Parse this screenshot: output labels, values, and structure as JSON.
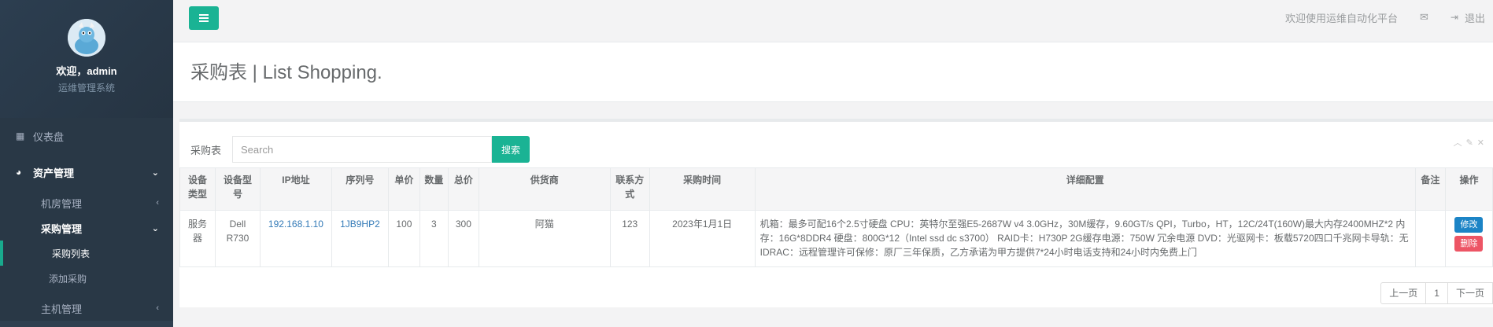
{
  "sidebar": {
    "welcome": "欢迎，admin",
    "role": "运维管理系统",
    "dashboard": "仪表盘",
    "asset_group": "资产管理",
    "sub_room": "机房管理",
    "sub_purchase": "采购管理",
    "purchase_list": "采购列表",
    "purchase_add": "添加采购",
    "sub_host": "主机管理"
  },
  "topbar": {
    "welcome_msg": "欢迎使用运维自动化平台",
    "logout": "退出"
  },
  "page": {
    "title": "采购表 | List Shopping."
  },
  "panel": {
    "search_label": "采购表",
    "search_placeholder": "Search",
    "search_button": "搜索"
  },
  "table": {
    "headers": [
      "设备类型",
      "设备型号",
      "IP地址",
      "序列号",
      "单价",
      "数量",
      "总价",
      "供货商",
      "联系方式",
      "采购时间",
      "详细配置",
      "备注",
      "操作"
    ],
    "rows": [
      {
        "type": "服务器",
        "model": "Dell R730",
        "ip": "192.168.1.10",
        "serial": "1JB9HP2",
        "unit_price": "100",
        "quantity": "3",
        "total": "300",
        "supplier": "阿猫",
        "contact": "123",
        "date": "2023年1月1日",
        "detail": "机箱：最多可配16个2.5寸硬盘 CPU：英特尔至强E5-2687W v4 3.0GHz，30M缓存，9.60GT/s QPI，Turbo，HT，12C/24T(160W)最大内存2400MHZ*2 内存：16G*8DDR4 硬盘：800G*12（Intel ssd dc s3700） RAID卡：H730P 2G缓存电源：750W 冗余电源 DVD：光驱网卡：板载5720四口千兆网卡导轨：无 IDRAC：远程管理许可保修：原厂三年保质，乙方承诺为甲方提供7*24小时电话支持和24小时内免费上门",
        "remark": "",
        "edit": "修改",
        "delete": "删除"
      }
    ]
  },
  "pager": {
    "prev": "上一页",
    "current": "1",
    "next": "下一页"
  },
  "colors": {
    "accent": "#1ab394",
    "sidebar_bg": "#2f4050",
    "link": "#337ab7",
    "danger": "#ed5565",
    "primary": "#1c84c6"
  },
  "icons": [
    "hamburger-icon",
    "envelope-icon",
    "sign-out-icon",
    "dashboard-icon",
    "asset-icon",
    "chevron-down-icon",
    "chevron-left-icon",
    "collapse-icon",
    "wrench-icon",
    "close-icon"
  ]
}
